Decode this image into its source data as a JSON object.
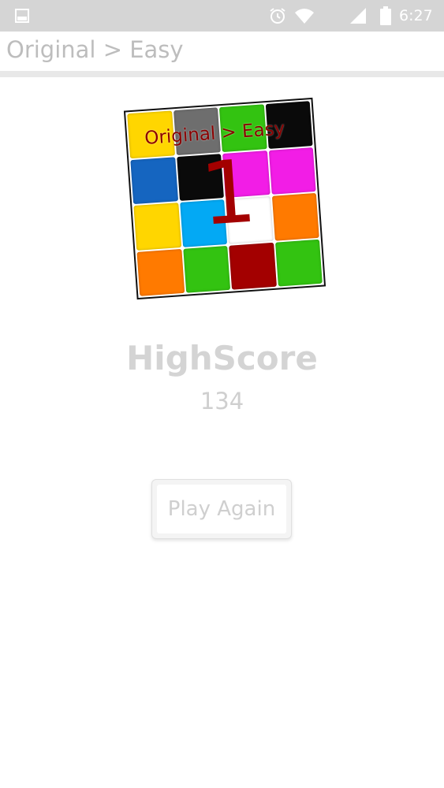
{
  "status_bar": {
    "time": "6:27",
    "icons": [
      "notification-image-icon",
      "alarm-icon",
      "wifi-icon",
      "signal-icon",
      "battery-icon"
    ]
  },
  "action_bar": {
    "title": "Original > Easy"
  },
  "puzzle_preview": {
    "caption": "Original > Easy",
    "level": "1",
    "tiles": [
      "#ffd600",
      "#6e6e6e",
      "#33c311",
      "#0a0a0a",
      "#1565c0",
      "#0a0a0a",
      "#f21de6",
      "#f21de6",
      "#ffd600",
      "#03a9f4",
      "#ffffff",
      "#ff7a00",
      "#ff7a00",
      "#33c311",
      "#a30000",
      "#33c311"
    ]
  },
  "highscore": {
    "label": "HighScore",
    "value": "134"
  },
  "buttons": {
    "play_again": "Play Again"
  }
}
